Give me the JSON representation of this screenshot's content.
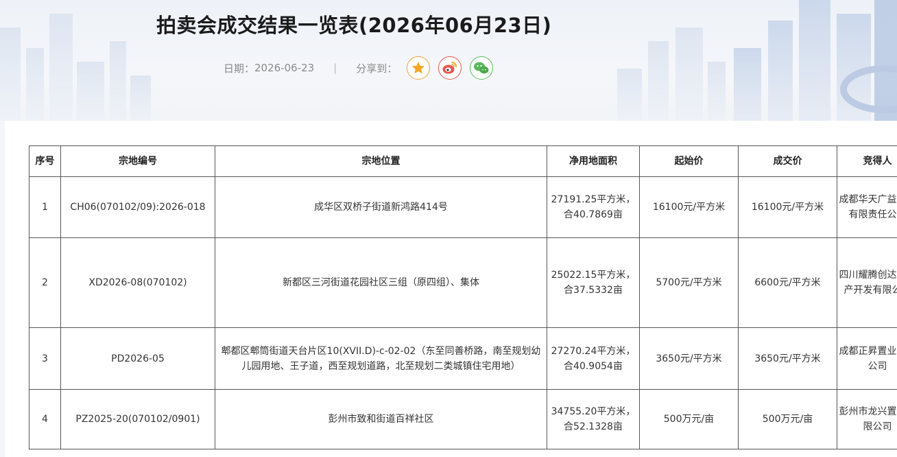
{
  "page": {
    "title": "拍卖会成交结果一览表(2026年06月23日)",
    "date_label": "日期：",
    "date": "2026-06-23",
    "separator": "|",
    "share_label": "分享到：",
    "share_icons": [
      "star-favorite-icon",
      "weibo-icon",
      "wechat-icon"
    ]
  },
  "colors": {
    "favorite": "#f0a23a",
    "weibo": "#e8544a",
    "wechat": "#5bb85d"
  },
  "table": {
    "headers": [
      "序号",
      "宗地编号",
      "宗地位置",
      "净用地面积",
      "起始价",
      "成交价",
      "竞得人"
    ],
    "rows": [
      {
        "no": "1",
        "code": "CH06(070102/09):2026-018",
        "location": "成华区双桥子街道新鸿路414号",
        "area": "27191.25平方米，合40.7869亩",
        "start_price": "16100元/平方米",
        "deal_price": "16100元/平方米",
        "winner": "成都华天广益置地有限责任公司"
      },
      {
        "no": "2",
        "code": "XD2026-08(070102)",
        "location": "新都区三河街道花园社区三组（原四组）、集体",
        "area": "25022.15平方米，合37.5332亩",
        "start_price": "5700元/平方米",
        "deal_price": "6600元/平方米",
        "winner": "四川耀腾创达房地产开发有限公司"
      },
      {
        "no": "3",
        "code": "PD2026-05",
        "location": "郫都区郫筒街道天台片区10(XVII.D)-c-02-02（东至同善桥路，南至规划幼儿园用地、王子道，西至规划道路，北至规划二类城镇住宅用地）",
        "area": "27270.24平方米，合40.9054亩",
        "start_price": "3650元/平方米",
        "deal_price": "3650元/平方米",
        "winner": "成都正昇置业有限公司"
      },
      {
        "no": "4",
        "code": "PZ2025-20(070102/0901)",
        "location": "彭州市致和街道百祥社区",
        "area": "34755.20平方米，合52.1328亩",
        "start_price": "500万元/亩",
        "deal_price": "500万元/亩",
        "winner": "彭州市龙兴置业有限公司"
      }
    ]
  }
}
